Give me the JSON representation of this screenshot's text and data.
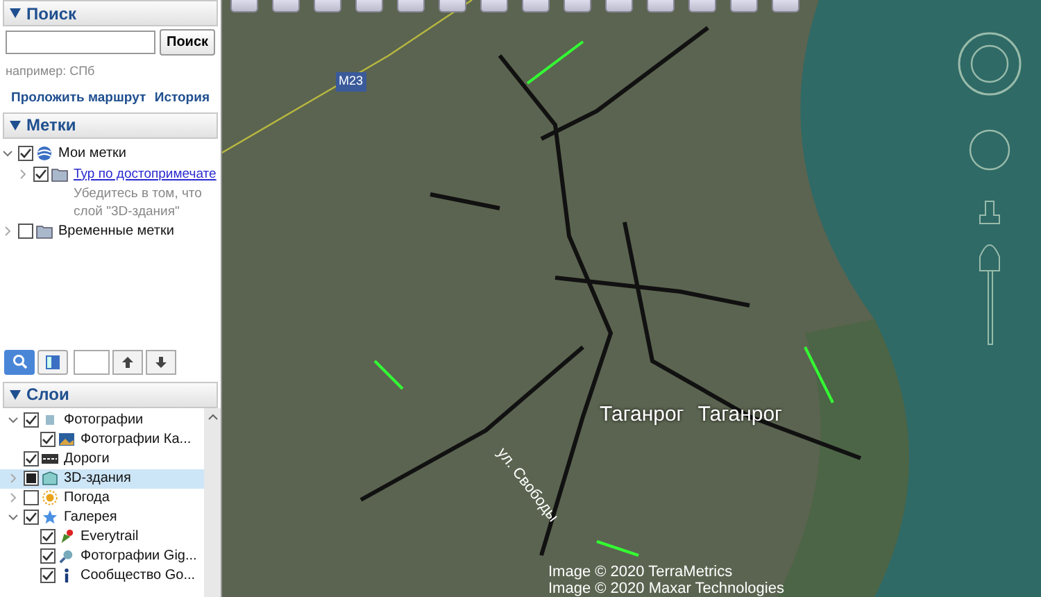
{
  "search": {
    "header": "Поиск",
    "button": "Поиск",
    "hint": "например: СПб",
    "links": [
      "Проложить маршрут",
      "История"
    ]
  },
  "places": {
    "header": "Метки",
    "items": [
      {
        "label": "Мои метки",
        "checked": true,
        "expanded": true,
        "link": false,
        "children": [
          {
            "label": "Тур по достопримечате",
            "checked": true,
            "expanded": false,
            "link": true,
            "note": "Убедитесь в том, что слой \"3D-здания\""
          }
        ]
      },
      {
        "label": "Временные метки",
        "checked": false,
        "expanded": false,
        "link": false
      }
    ]
  },
  "layers": {
    "header": "Слои",
    "items": [
      {
        "label": "Фотографии",
        "checked": true,
        "partial": false,
        "expanded": true,
        "selected": false,
        "children": [
          {
            "label": "Фотографии Ка...",
            "checked": true,
            "partial": false,
            "selected": false
          }
        ]
      },
      {
        "label": "Дороги",
        "checked": true,
        "partial": false,
        "selected": false
      },
      {
        "label": "3D-здания",
        "checked": false,
        "partial": true,
        "expanded": false,
        "selected": true
      },
      {
        "label": "Погода",
        "checked": false,
        "partial": false,
        "expanded": false,
        "selected": false
      },
      {
        "label": "Галерея",
        "checked": true,
        "partial": false,
        "expanded": true,
        "selected": false,
        "children": [
          {
            "label": "Everytrail",
            "checked": true,
            "partial": false,
            "selected": false
          },
          {
            "label": "Фотографии Gig...",
            "checked": true,
            "partial": false,
            "selected": false
          },
          {
            "label": "Сообщество Go...",
            "checked": true,
            "partial": false,
            "selected": false
          }
        ]
      }
    ]
  },
  "map": {
    "labels": [
      {
        "kind": "road",
        "text": "M23"
      },
      {
        "kind": "street",
        "text": "ул. Свободы"
      },
      {
        "kind": "city",
        "text": "Таганрог"
      },
      {
        "kind": "city",
        "text": "Таганрог"
      }
    ],
    "credits": [
      "Image © 2020 TerraMetrics",
      "Image © 2020 Maxar Technologies"
    ]
  }
}
